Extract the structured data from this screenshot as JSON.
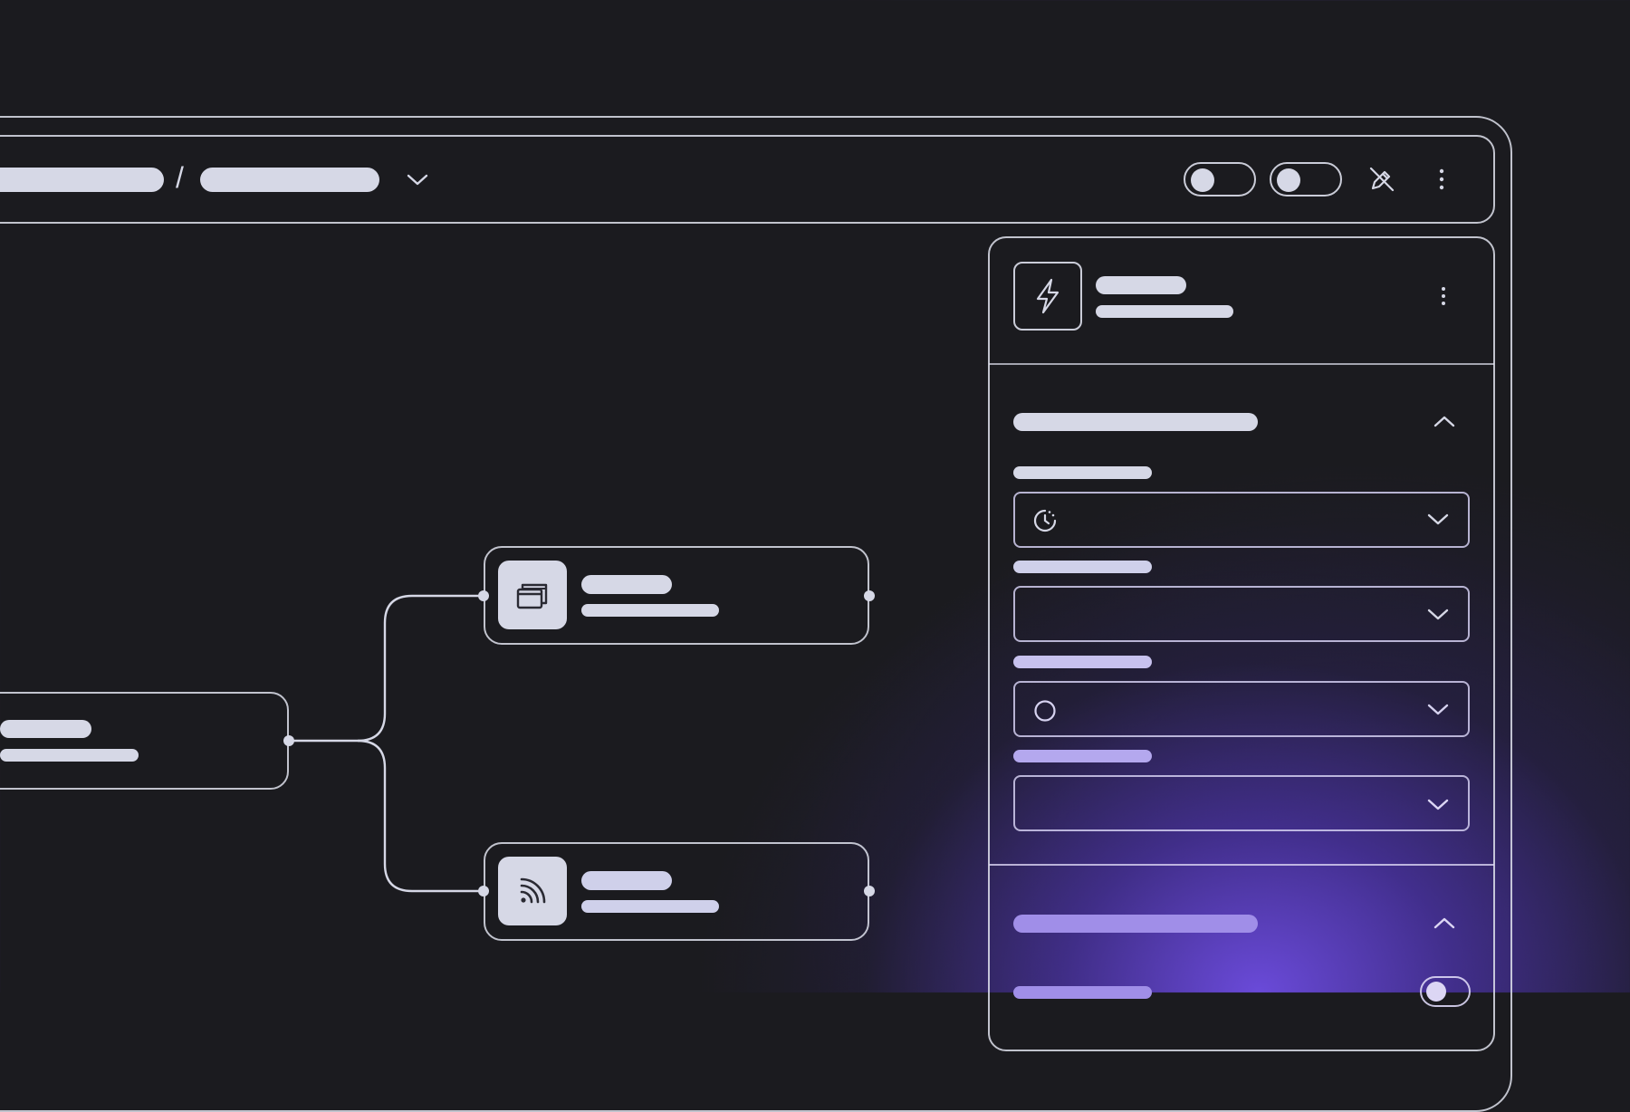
{
  "colors": {
    "background": "#1b1b1f",
    "outline": "#dee0ec",
    "placeholder_light": "#d6d8e6",
    "placeholder_lavender_1": "#c7c1ee",
    "placeholder_lavender_2": "#b4a8ee",
    "placeholder_violet": "#a08ee8",
    "glow": "#704ee6"
  },
  "toolbar": {
    "breadcrumb_separator": "/",
    "toggles": [
      {
        "state": "off"
      },
      {
        "state": "off"
      }
    ],
    "icons": [
      "chevron-down-icon",
      "pen-off-icon",
      "kebab-menu-icon"
    ]
  },
  "canvas": {
    "nodes": [
      {
        "kind": "source",
        "icon": null
      },
      {
        "kind": "branch-top",
        "icon": "windows-stack-icon"
      },
      {
        "kind": "branch-bottom",
        "icon": "feed-icon"
      }
    ]
  },
  "panel": {
    "header_icon": "lightning-icon",
    "sections": [
      {
        "expanded": true,
        "fields": [
          {
            "icon": "clock-dashed-icon"
          },
          {
            "icon": null
          },
          {
            "icon": "circle-icon"
          },
          {
            "icon": null
          }
        ]
      },
      {
        "expanded": true,
        "fields": [
          {
            "toggle": "off"
          }
        ]
      }
    ]
  }
}
